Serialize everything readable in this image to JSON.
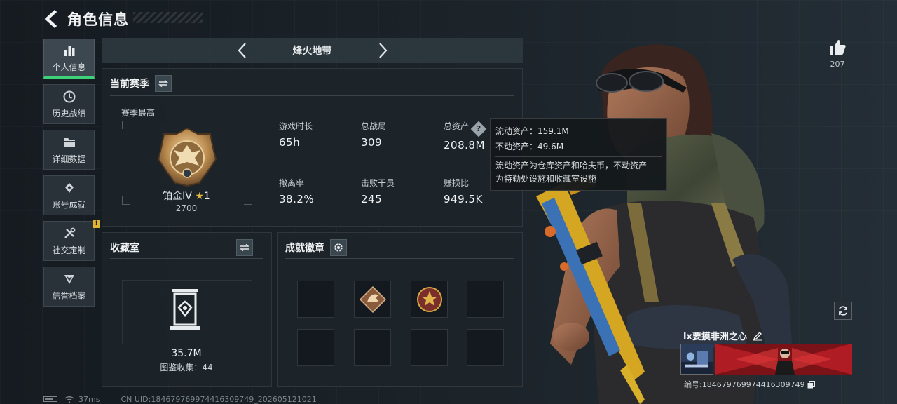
{
  "header": {
    "title": "角色信息"
  },
  "sidebar": {
    "items": [
      {
        "label": "个人信息",
        "icon": "bar-chart-icon",
        "active": true
      },
      {
        "label": "历史战绩",
        "icon": "history-icon"
      },
      {
        "label": "详细数据",
        "icon": "folder-icon"
      },
      {
        "label": "账号成就",
        "icon": "achievement-icon"
      },
      {
        "label": "社交定制",
        "icon": "tools-icon",
        "badge": "!"
      },
      {
        "label": "信誉档案",
        "icon": "shield-down-icon"
      }
    ]
  },
  "mode": {
    "name": "烽火地带"
  },
  "season": {
    "title": "当前赛季",
    "best_label": "赛季最高",
    "rank_name": "铂金IV",
    "rank_stars": "1",
    "rank_points": "2700",
    "stats": [
      {
        "label": "游戏时长",
        "value": "65h"
      },
      {
        "label": "总战局",
        "value": "309"
      },
      {
        "label": "总资产",
        "value": "208.8M"
      },
      {
        "label": "撤离率",
        "value": "38.2%"
      },
      {
        "label": "击败干员",
        "value": "245"
      },
      {
        "label": "赚损比",
        "value": "949.5K"
      }
    ]
  },
  "tooltip": {
    "liquid": "流动资产：159.1M",
    "fixed": "不动资产：49.6M",
    "note_line1": "流动资产为仓库资产和哈夫币，不动资产",
    "note_line2": "为特勤处设施和收藏室设施"
  },
  "collection": {
    "title": "收藏室",
    "value": "35.7M",
    "count_text": "图鉴收集：44"
  },
  "achievements": {
    "title": "成就徽章"
  },
  "profile": {
    "likes": "207",
    "player_name": "lx要摸非洲之心",
    "player_id": "编号:1846797699744163097​49"
  },
  "statusbar": {
    "ping": "37ms",
    "uid": "CN UID:184679769974416309749_202605121021"
  },
  "colors": {
    "accent_green": "#3fd07a",
    "badge_yellow": "#e0b533",
    "panel_bg": "#1c242a"
  }
}
